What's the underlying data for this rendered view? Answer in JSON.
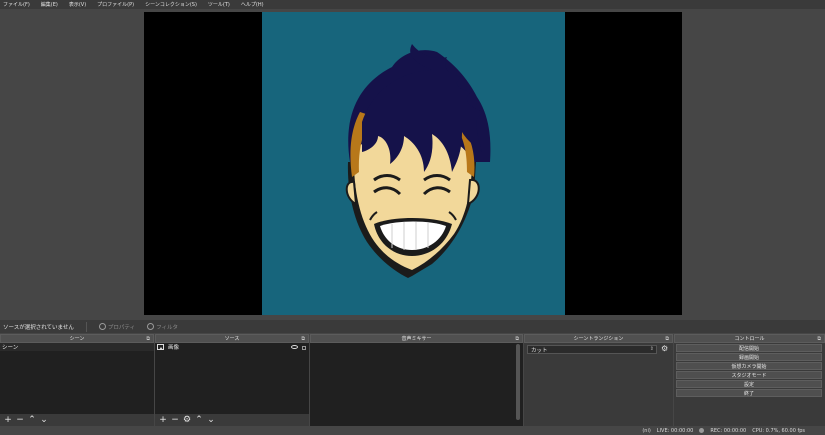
{
  "menu": [
    "ファイル(F)",
    "編集(E)",
    "表示(V)",
    "プロファイル(P)",
    "シーンコレクション(S)",
    "ツール(T)",
    "ヘルプ(H)"
  ],
  "preview": {
    "background_color": "#17657c",
    "character": "smiling-boy-illustration"
  },
  "source_status": {
    "text": "ソースが選択されていません",
    "properties_label": "プロパティ",
    "filters_label": "フィルタ"
  },
  "docks": {
    "scenes": {
      "title": "シーン",
      "items": [
        "シーン"
      ]
    },
    "sources": {
      "title": "ソース",
      "items": [
        {
          "name": "画像"
        }
      ]
    },
    "mixer": {
      "title": "音声ミキサー"
    },
    "transitions": {
      "title": "シーントランジション",
      "selected": "カット"
    },
    "controls": {
      "title": "コントロール",
      "buttons": [
        "配信開始",
        "録画開始",
        "仮想カメラ開始",
        "スタジオモード",
        "設定",
        "終了"
      ]
    }
  },
  "statusbar": {
    "dropped": "(ni)",
    "live": "LIVE: 00:00:00",
    "rec": "REC: 00:00:00",
    "cpu": "CPU: 0.7%, 60.00 fps"
  },
  "colors": {
    "accent": "#17657c",
    "panel": "#3a3a3a",
    "dock_body": "#202020"
  }
}
